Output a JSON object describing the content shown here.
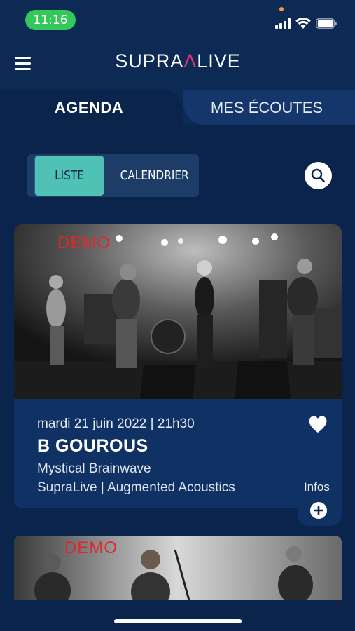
{
  "status_bar": {
    "time": "11:16"
  },
  "header": {
    "logo_left": "SUPRA",
    "logo_mark": "Λ",
    "logo_right": "LIVE"
  },
  "tabs": [
    {
      "label": "AGENDA",
      "active": true
    },
    {
      "label": "MES ÉCOUTES",
      "active": false
    }
  ],
  "view_toggle": {
    "list_label": "LISTE",
    "calendar_label": "CALENDRIER",
    "selected": "LISTE"
  },
  "events": [
    {
      "watermark": "DEMO",
      "date": "mardi 21 juin 2022 | 21h30",
      "title": "B GOUROUS",
      "subtitle": "Mystical Brainwave",
      "venue": "SupraLive | Augmented Acoustics",
      "infos_label": "Infos"
    },
    {
      "watermark": "DEMO"
    }
  ],
  "icons": {
    "menu": "hamburger-menu-icon",
    "search": "search-icon",
    "favorite": "heart-icon",
    "more": "plus-icon"
  },
  "colors": {
    "background": "#0a244c",
    "accent": "#4fc1b5",
    "logo_accent": "#e0307a",
    "status_time": "#34c759"
  }
}
